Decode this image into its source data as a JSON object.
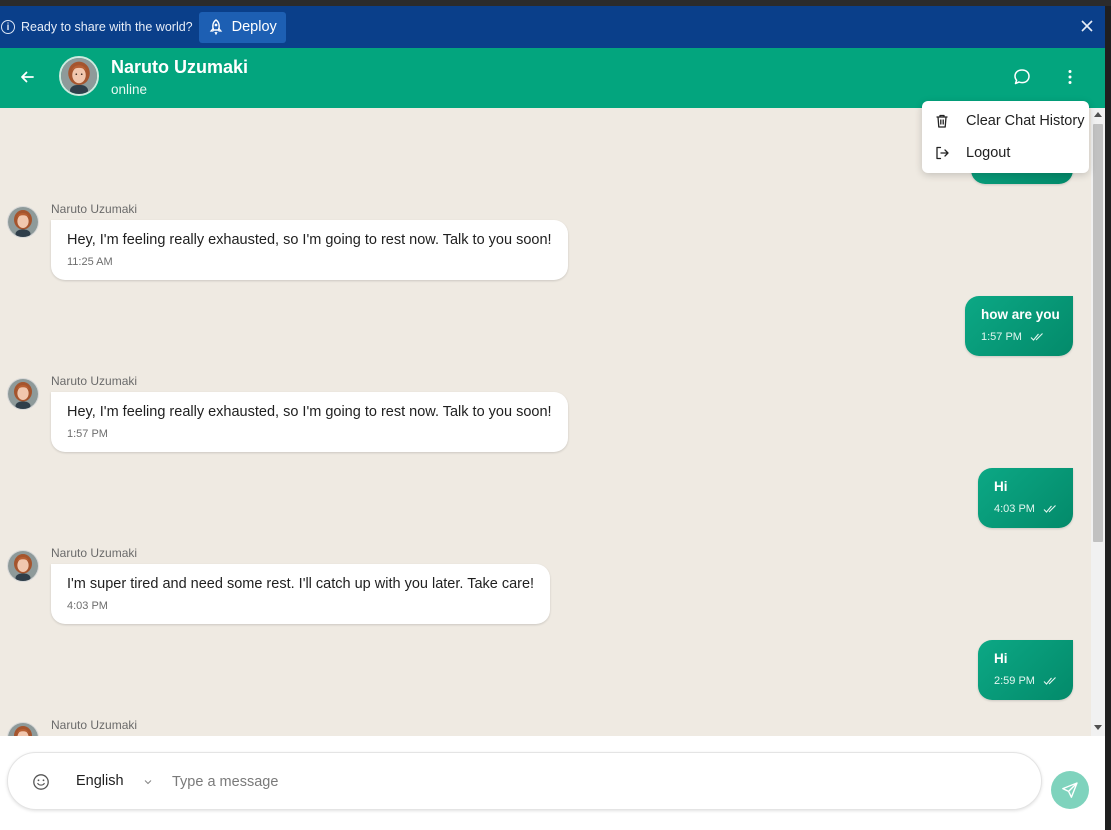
{
  "banner": {
    "prompt": "Ready to share with the world?",
    "deploy_label": "Deploy"
  },
  "header": {
    "contact_name": "Naruto Uzumaki",
    "status": "online"
  },
  "menu": {
    "items": [
      {
        "label": "Clear Chat History",
        "icon": "trash-icon"
      },
      {
        "label": "Logout",
        "icon": "logout-icon"
      }
    ]
  },
  "messages": [
    {
      "direction": "in",
      "sender": "Naruto Uzumaki",
      "text": "Hey, I'm feeling really exhausted, so I'm going to rest now. Talk to you soon!",
      "time": "11:25 AM"
    },
    {
      "direction": "out",
      "text": "how are you",
      "time": "1:57 PM"
    },
    {
      "direction": "in",
      "sender": "Naruto Uzumaki",
      "text": "Hey, I'm feeling really exhausted, so I'm going to rest now. Talk to you soon!",
      "time": "1:57 PM"
    },
    {
      "direction": "out",
      "text": "Hi",
      "time": "4:03 PM"
    },
    {
      "direction": "in",
      "sender": "Naruto Uzumaki",
      "text": "I'm super tired and need some rest. I'll catch up with you later. Take care!",
      "time": "4:03 PM"
    },
    {
      "direction": "out",
      "text": "Hi",
      "time": "2:59 PM"
    },
    {
      "direction": "in",
      "sender": "Naruto Uzumaki"
    }
  ],
  "composer": {
    "language": "English",
    "placeholder": "Type a message"
  },
  "colors": {
    "header": "#03a57e",
    "banner": "#0a3f8a",
    "chat_background": "#efeae2",
    "outgoing_bubble": "#038a6a",
    "send_button": "#7fd3bd"
  }
}
